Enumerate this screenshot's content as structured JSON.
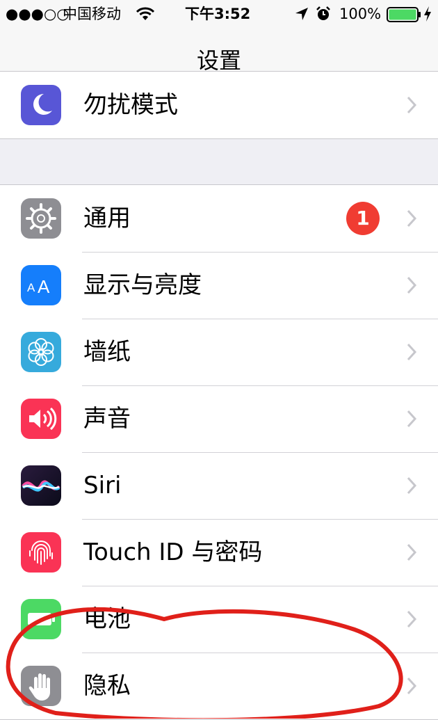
{
  "status_bar": {
    "signal": "●●●○○",
    "carrier": "中国移动",
    "time": "下午3:52",
    "battery_percent": "100%",
    "battery_level": 1.0
  },
  "nav": {
    "title": "设置"
  },
  "colors": {
    "dnd": "#5856d6",
    "general": "#8e8e93",
    "display": "#157efb",
    "wallpaper": "#36aadc",
    "sounds": "#fa3355",
    "touchid": "#fa3355",
    "battery": "#4cd964",
    "privacy": "#8e8e93",
    "badge": "#f03c32",
    "annotation": "#e0201a"
  },
  "rows": {
    "dnd": {
      "label": "勿扰模式",
      "icon": "moon-icon"
    },
    "general": {
      "label": "通用",
      "icon": "gear-icon",
      "badge": "1"
    },
    "display": {
      "label": "显示与亮度",
      "icon": "text-size-icon",
      "glyph": "AA"
    },
    "wallpaper": {
      "label": "墙纸",
      "icon": "flower-icon"
    },
    "sounds": {
      "label": "声音",
      "icon": "speaker-icon"
    },
    "siri": {
      "label": "Siri",
      "icon": "siri-wave-icon"
    },
    "touchid": {
      "label": "Touch ID 与密码",
      "icon": "fingerprint-icon"
    },
    "battery": {
      "label": "电池",
      "icon": "battery-icon"
    },
    "privacy": {
      "label": "隐私",
      "icon": "hand-icon"
    }
  }
}
